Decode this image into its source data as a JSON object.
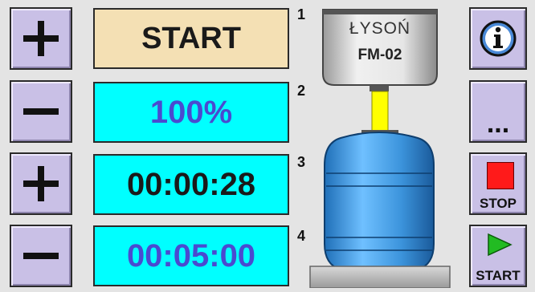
{
  "left_controls": {
    "plus_1": "+",
    "minus_2": "−",
    "plus_3": "+",
    "minus_4": "−"
  },
  "displays": {
    "state_label": "START",
    "speed_percent": "100%",
    "elapsed_time": "00:00:28",
    "set_time": "00:05:00"
  },
  "row_numbers": [
    "1",
    "2",
    "3",
    "4"
  ],
  "device": {
    "brand": "ŁYSOŃ",
    "model": "FM-02"
  },
  "right_controls": {
    "info_icon": "info-icon",
    "more_label": "...",
    "stop_label": "STOP",
    "start_label": "START"
  },
  "colors": {
    "button_bg": "#c9c0e6",
    "display_cyan": "#00ffff",
    "display_cream": "#f4e0b4",
    "stop_red": "#ff1a1a",
    "start_green": "#22bb22",
    "tank_blue": "#4aa0e0",
    "hose_yellow": "#ffff00"
  }
}
